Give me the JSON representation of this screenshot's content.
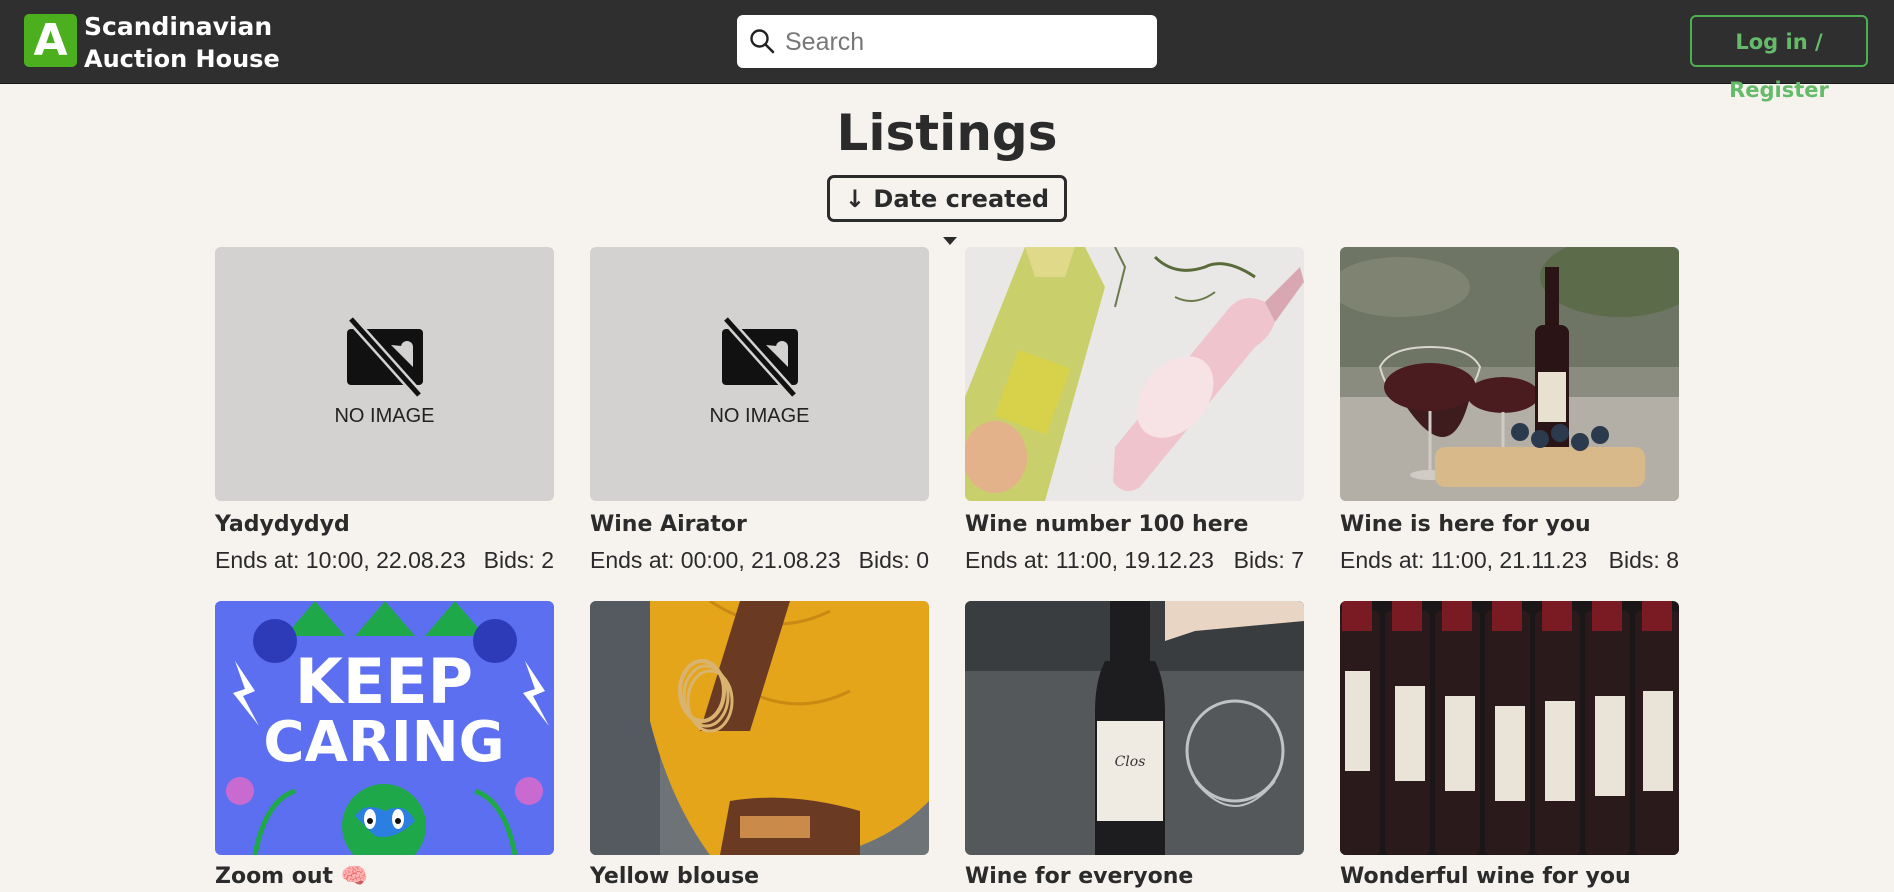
{
  "header": {
    "logo_letter": "A",
    "brand_line1": "Scandinavian",
    "brand_line2": "Auction House",
    "search_placeholder": "Search",
    "login_label": "Log in / Register"
  },
  "page": {
    "title": "Listings",
    "sort_label": "Date created",
    "sort_direction_glyph": "↓"
  },
  "no_image_text": "NO IMAGE",
  "listings": [
    {
      "title": "Yadydydyd",
      "ends": "Ends at: 10:00, 22.08.23",
      "bids": "Bids: 2",
      "image": "no-image"
    },
    {
      "title": "Wine Airator",
      "ends": "Ends at: 00:00, 21.08.23",
      "bids": "Bids: 0",
      "image": "no-image"
    },
    {
      "title": "Wine number 100 here",
      "ends": "Ends at: 11:00, 19.12.23",
      "bids": "Bids: 7",
      "image": "wine-bottles-photo"
    },
    {
      "title": "Wine is here for you",
      "ends": "Ends at: 11:00, 21.11.23",
      "bids": "Bids: 8",
      "image": "wine-glasses-photo"
    },
    {
      "title": "Zoom out 🧠",
      "image": "keep-caring-illustration"
    },
    {
      "title": "Yellow blouse",
      "image": "yellow-blouse-photo"
    },
    {
      "title": "Wine for everyone",
      "image": "wine-bottle-photo"
    },
    {
      "title": "Wonderful wine for you",
      "image": "wine-rack-photo"
    }
  ],
  "colors": {
    "header_bg": "#2f2f2f",
    "page_bg": "#f6f3ef",
    "brand_green": "#4caf1e",
    "login_green": "#66bb6a"
  }
}
